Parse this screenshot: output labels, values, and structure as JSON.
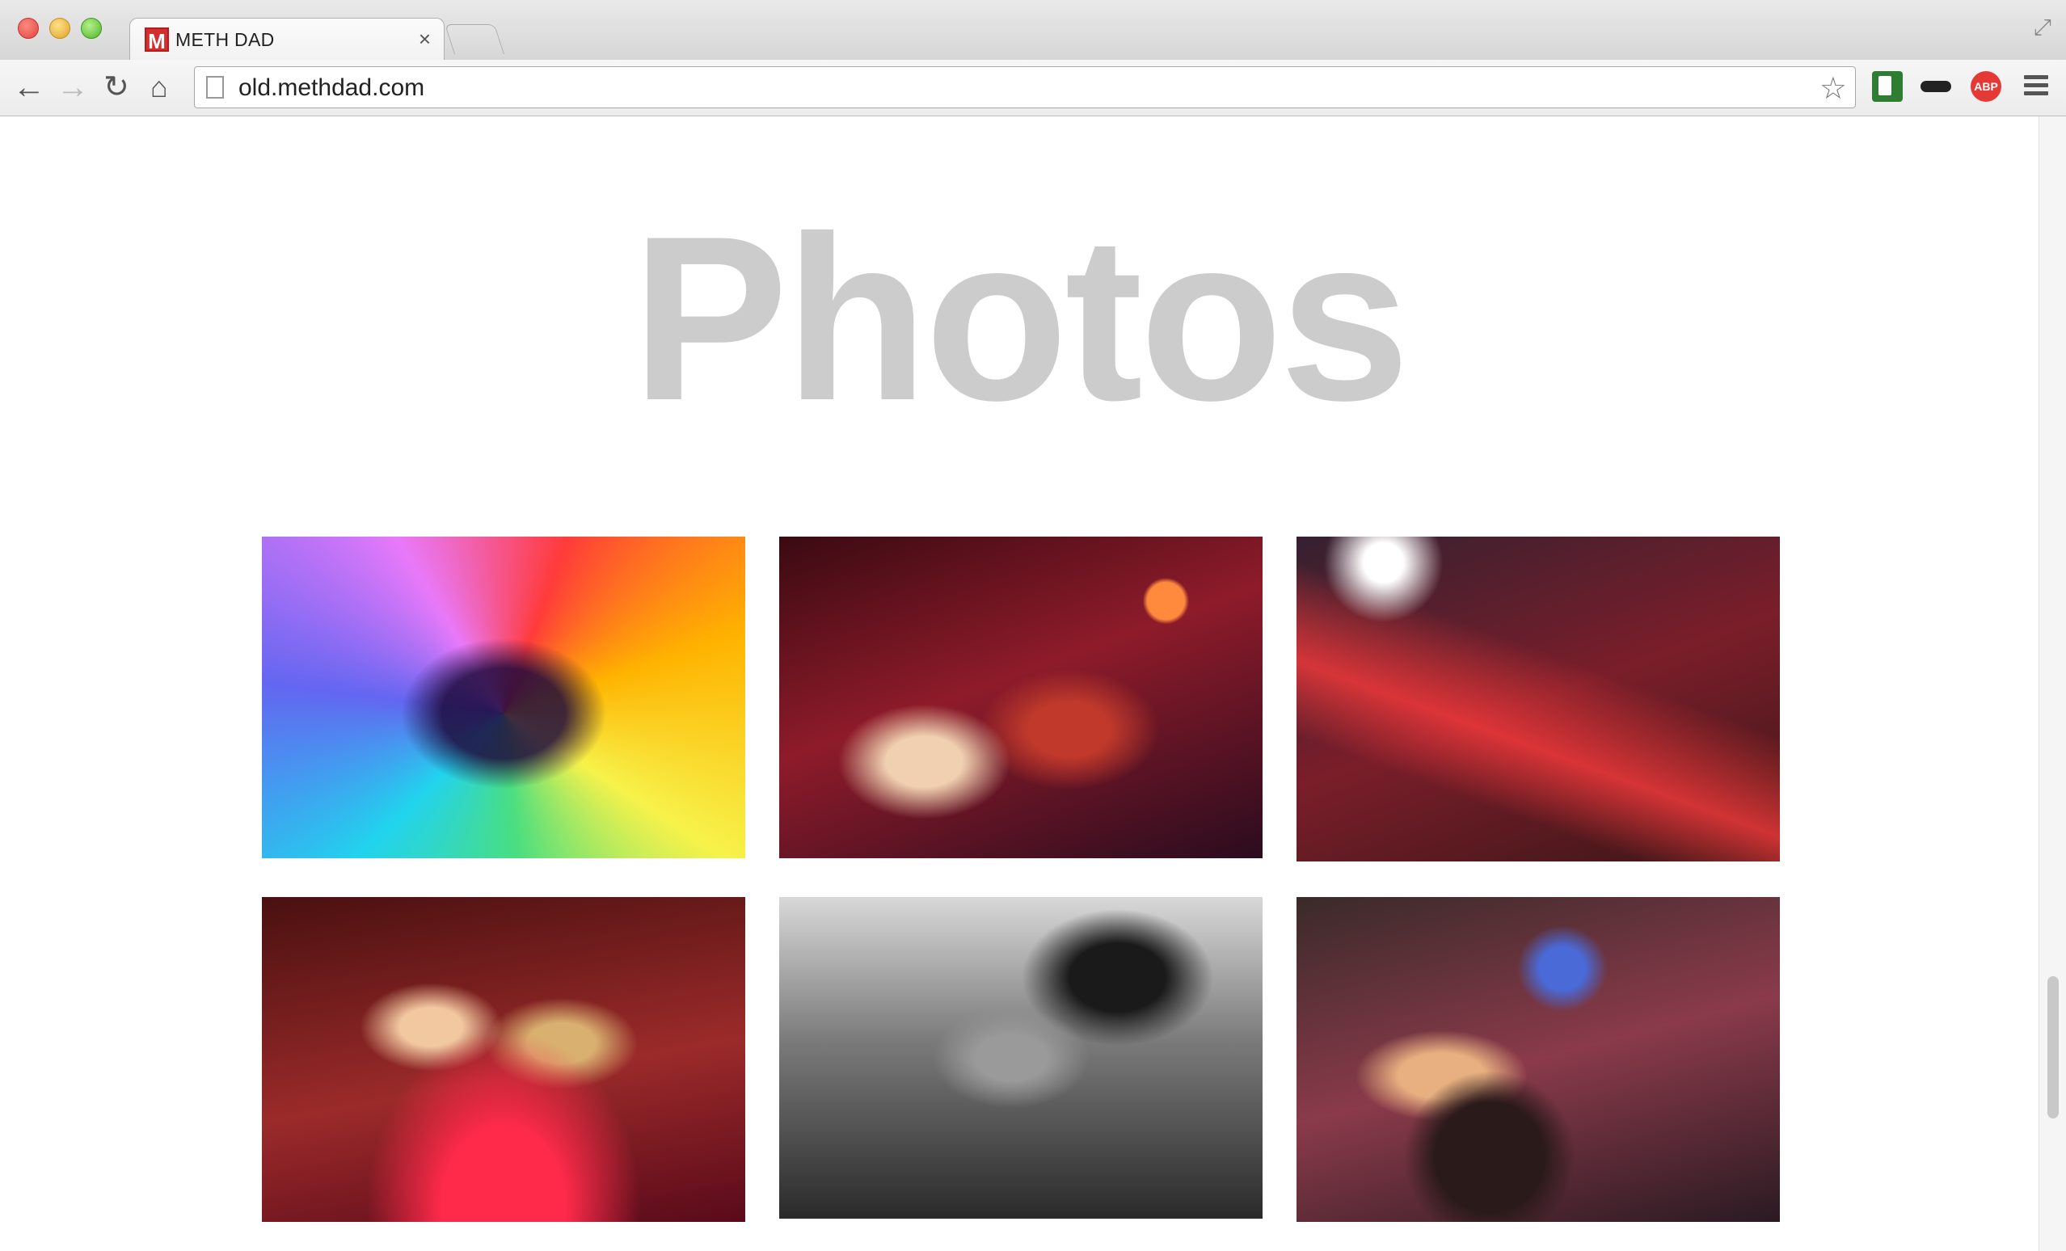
{
  "browser": {
    "tab": {
      "title": "METH DAD",
      "favicon_letter": "M",
      "close": "×"
    },
    "toolbar": {
      "back": "←",
      "forward": "→",
      "reload": "↻",
      "home": "⌂",
      "url": "old.methdad.com",
      "star": "☆",
      "extensions": {
        "abp_label": "ABP"
      }
    },
    "fullscreen": "⤢"
  },
  "page": {
    "heading": "Photos",
    "photos": [
      {
        "icon": "tie-dye-artwork-photo"
      },
      {
        "icon": "party-crowd-photo"
      },
      {
        "icon": "crowd-hands-up-photo"
      },
      {
        "icon": "singer-crowd-photo"
      },
      {
        "icon": "black-and-white-dancer-photo"
      },
      {
        "icon": "crowd-rainbow-hat-photo"
      }
    ]
  },
  "colors": {
    "heading": "#cccccc",
    "background": "#ffffff",
    "abp": "#e53935"
  }
}
